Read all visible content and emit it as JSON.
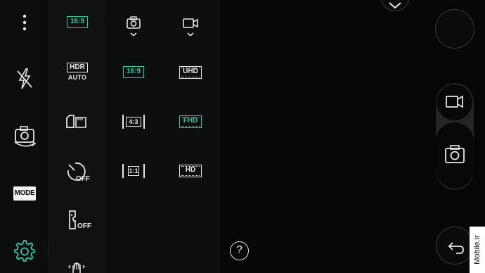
{
  "colors": {
    "accent": "#35c7a7",
    "icon": "#e8e8e8",
    "background": "#050606"
  },
  "left_rail": {
    "icons": [
      "more-vert-icon",
      "flash-off-icon",
      "switch-camera-icon",
      "mode-icon",
      "settings-icon"
    ],
    "mode_label": "MODE"
  },
  "settings_column": {
    "ratio_label": "16:9",
    "hdr_label": "HDR",
    "hdr_value": "AUTO",
    "timer_value": "OFF",
    "voice_shutter_value": "OFF",
    "icons": [
      "aspect-ratio-icon",
      "hdr-icon",
      "storage-sd-icon",
      "timer-icon",
      "voice-shutter-icon",
      "gesture-shot-icon"
    ]
  },
  "photo_size_column": {
    "header_icon": "photo-camera-icon",
    "options": [
      "16:9",
      "4:3",
      "1:1"
    ],
    "selected": "16:9"
  },
  "video_size_column": {
    "header_icon": "video-camera-icon",
    "options": [
      "UHD",
      "FHD",
      "HD"
    ],
    "selected": "FHD"
  },
  "help": {
    "label": "?"
  },
  "right_controls": {
    "icons": [
      "chevron-down-icon",
      "gallery-thumb",
      "video-record-icon",
      "shutter-camera-icon",
      "back-icon"
    ]
  },
  "watermark": "Mobile.ir"
}
